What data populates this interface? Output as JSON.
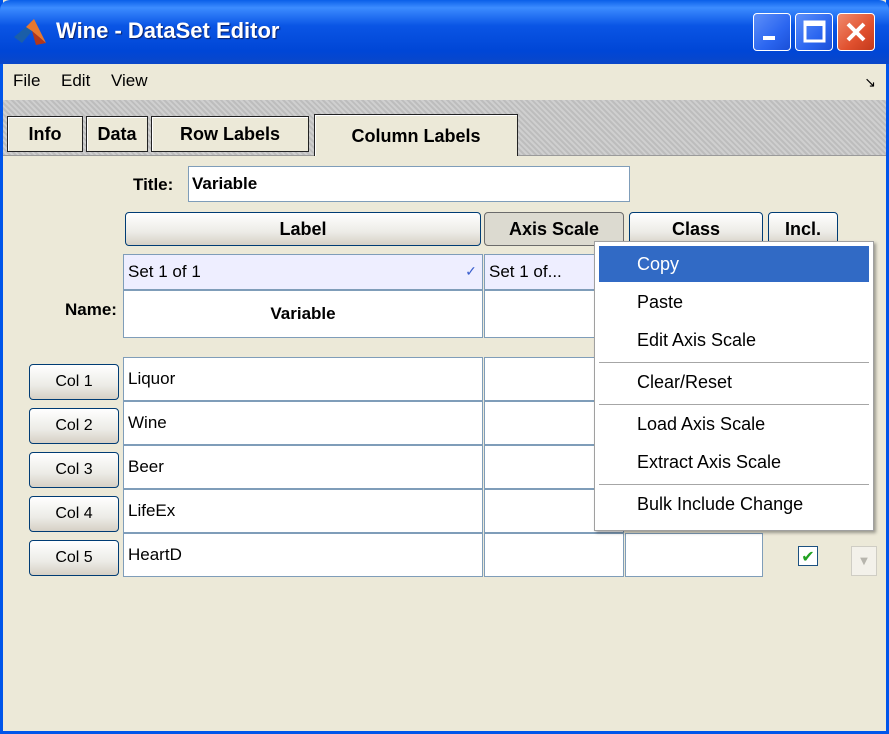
{
  "window": {
    "title": "Wine - DataSet Editor"
  },
  "menubar": {
    "items": [
      "File",
      "Edit",
      "View"
    ]
  },
  "tabs": [
    "Info",
    "Data",
    "Row Labels",
    "Column Labels"
  ],
  "active_tab": "Column Labels",
  "title_field": {
    "label": "Title:",
    "value": "Variable"
  },
  "column_headers": [
    "Label",
    "Axis Scale",
    "Class",
    "Incl."
  ],
  "set_selectors": {
    "label": "Set 1 of 1",
    "axis_scale": "Set 1 of..."
  },
  "name_row": {
    "label": "Name:",
    "label_value": "Variable"
  },
  "rows": [
    {
      "button": "Col 1",
      "label": "Liquor"
    },
    {
      "button": "Col 2",
      "label": "Wine"
    },
    {
      "button": "Col 3",
      "label": "Beer"
    },
    {
      "button": "Col 4",
      "label": "LifeEx"
    },
    {
      "button": "Col 5",
      "label": "HeartD"
    }
  ],
  "context_menu": {
    "items": [
      "Copy",
      "Paste",
      "Edit Axis Scale",
      "Clear/Reset",
      "Load Axis Scale",
      "Extract Axis Scale",
      "Bulk Include Change"
    ],
    "selected": "Copy"
  },
  "colors": {
    "title_bar": "#0a55e5",
    "selection": "#316ac5",
    "check": "#21a121"
  }
}
